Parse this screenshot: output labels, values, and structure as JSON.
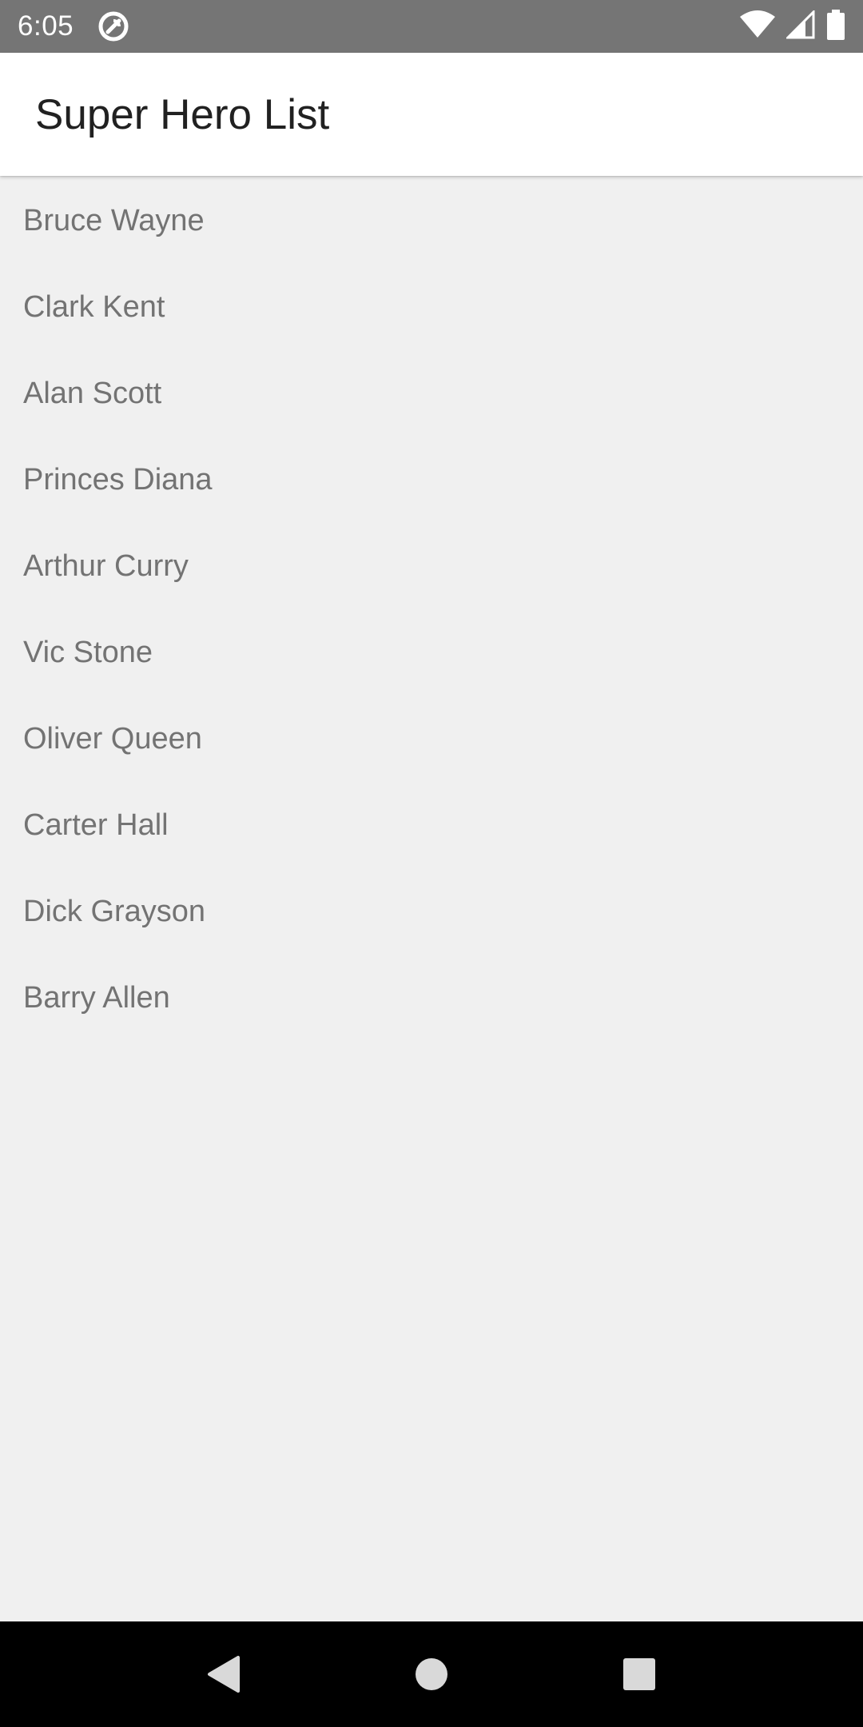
{
  "status_bar": {
    "time": "6:05"
  },
  "app_bar": {
    "title": "Super Hero List"
  },
  "heroes": [
    "Bruce Wayne",
    "Clark Kent",
    "Alan Scott",
    "Princes Diana",
    "Arthur Curry",
    "Vic Stone",
    "Oliver Queen",
    "Carter Hall",
    "Dick Grayson",
    "Barry Allen"
  ],
  "icons": {
    "status_app": "notification-app-icon",
    "wifi": "wifi-icon",
    "signal": "cell-signal-icon",
    "battery": "battery-icon",
    "back": "back-icon",
    "home": "home-icon",
    "recents": "recents-icon"
  },
  "colors": {
    "status_bar": "#757575",
    "app_bar": "#ffffff",
    "background": "#f0f0f0",
    "item_text": "#737373",
    "nav_bar": "#000000"
  }
}
